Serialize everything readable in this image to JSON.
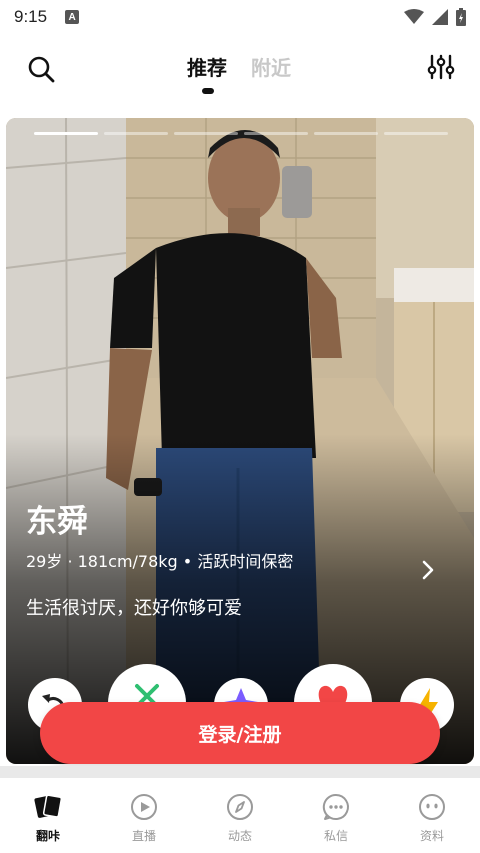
{
  "status_bar": {
    "time": "9:15",
    "notification_badge": "A",
    "icons": [
      "wifi-icon",
      "cellular-signal-icon",
      "battery-icon"
    ]
  },
  "top_nav": {
    "tabs": [
      {
        "label": "推荐",
        "active": true
      },
      {
        "label": "附近",
        "active": false
      }
    ],
    "left_icon": "search-icon",
    "right_icon": "filter-sliders-icon"
  },
  "card": {
    "photo_pages": {
      "total": 6,
      "current": 1
    },
    "name": "东舜",
    "meta": "29岁 · 181cm/78kg • 活跃时间保密",
    "bio": "生活很讨厌，还好你够可爱"
  },
  "actions": [
    {
      "name": "undo",
      "icon": "undo-icon"
    },
    {
      "name": "pass",
      "icon": "close-icon",
      "color": "#2fbf71"
    },
    {
      "name": "super-like",
      "icon": "star-icon",
      "color": "#7b5cff"
    },
    {
      "name": "like",
      "icon": "heart-icon",
      "color": "#f24646"
    },
    {
      "name": "boost",
      "icon": "lightning-icon",
      "color": "#f6b300"
    }
  ],
  "login_button": {
    "label": "登录/注册",
    "color": "#f24646"
  },
  "bottom_nav": {
    "items": [
      {
        "label": "翻咔",
        "icon": "cards-icon",
        "active": true
      },
      {
        "label": "直播",
        "icon": "play-circle-icon",
        "active": false
      },
      {
        "label": "动态",
        "icon": "compass-icon",
        "active": false
      },
      {
        "label": "私信",
        "icon": "chat-bubble-icon",
        "active": false
      },
      {
        "label": "资料",
        "icon": "profile-face-icon",
        "active": false
      }
    ]
  }
}
